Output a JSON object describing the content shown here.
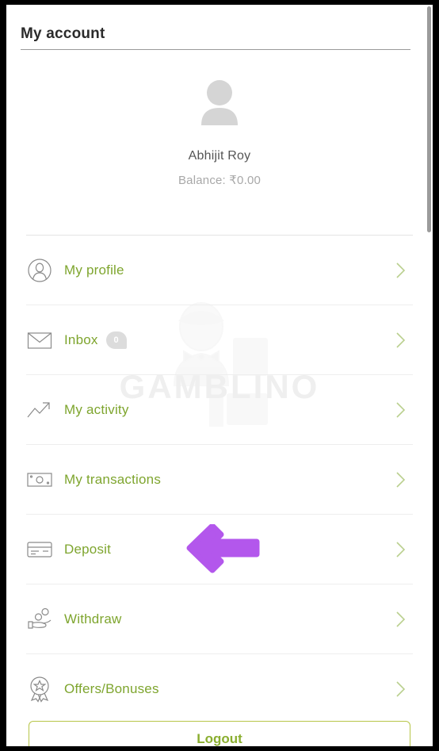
{
  "header": {
    "title": "My account"
  },
  "profile": {
    "avatar_icon": "user-silhouette-icon",
    "name": "Abhijit Roy",
    "balance": "Balance: ₹0.00"
  },
  "watermark": {
    "text": "GAMBLINO",
    "logo_icon": "gamblino-dealer-logo-watermark"
  },
  "menu": {
    "items": [
      {
        "label": "My profile",
        "icon": "user-circle-icon",
        "chevron": "chevron-right-icon"
      },
      {
        "label": "Inbox",
        "icon": "envelope-icon",
        "chevron": "chevron-right-icon",
        "badge": "0"
      },
      {
        "label": "My activity",
        "icon": "trend-up-icon",
        "chevron": "chevron-right-icon"
      },
      {
        "label": "My transactions",
        "icon": "banknote-icon",
        "chevron": "chevron-right-icon"
      },
      {
        "label": "Deposit",
        "icon": "credit-card-icon",
        "chevron": "chevron-right-icon"
      },
      {
        "label": "Withdraw",
        "icon": "hand-coins-icon",
        "chevron": "chevron-right-icon"
      },
      {
        "label": "Offers/Bonuses",
        "icon": "award-ribbon-icon",
        "chevron": "chevron-right-icon"
      }
    ]
  },
  "logout": {
    "label": "Logout"
  },
  "annotation": {
    "arrow_icon": "arrow-left-annotation",
    "color": "#b05ce8",
    "points_at": "Deposit"
  },
  "colors": {
    "accent_green": "#7ea52e",
    "logout_border": "#b7c648",
    "chevron": "#b9cf8d",
    "icon_gray": "#7d7d7d",
    "title": "#2b2b2b",
    "name": "#555555",
    "balance": "#a8a8a8",
    "badge_bg": "#dcdcdc",
    "arrow_purple": "#b05ce8"
  },
  "scrollbar": {
    "orientation": "vertical",
    "thumb_position": "top"
  }
}
